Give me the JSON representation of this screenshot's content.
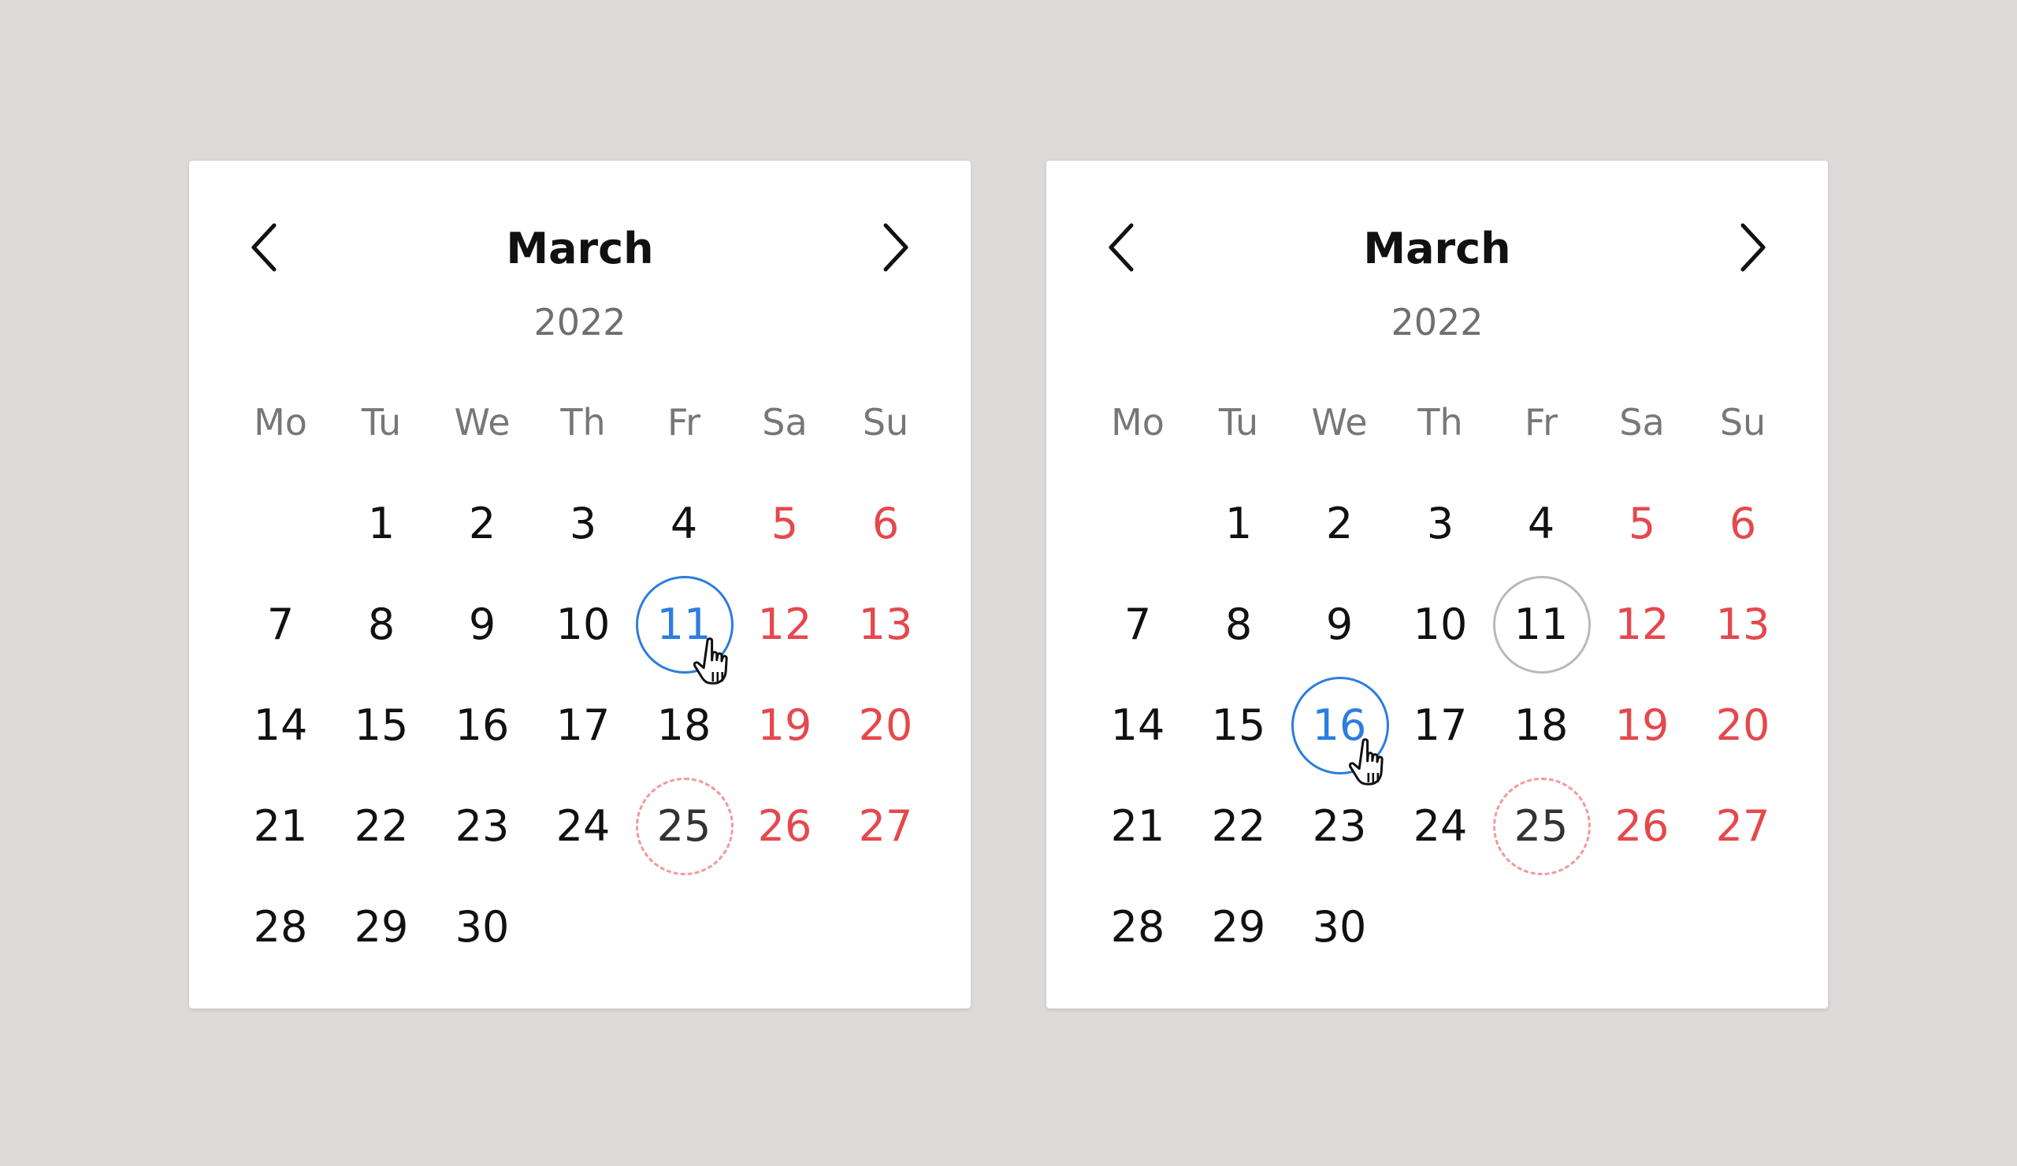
{
  "weekdays": [
    "Mo",
    "Tu",
    "We",
    "Th",
    "Fr",
    "Sa",
    "Su"
  ],
  "colors": {
    "background": "#dcdbda",
    "weekend": "#e5484d",
    "selected": "#2b7de0",
    "previous_ring": "#b9b9b9",
    "event_ring": "#f29a9a"
  },
  "icons": {
    "prev": "chevron-left-icon",
    "next": "chevron-right-icon",
    "cursor": "hand-pointer-icon"
  },
  "calendars": [
    {
      "month": "March",
      "year": "2022",
      "days": [
        {
          "label": "",
          "type": "blank"
        },
        {
          "label": "1",
          "type": "weekday"
        },
        {
          "label": "2",
          "type": "weekday"
        },
        {
          "label": "3",
          "type": "weekday"
        },
        {
          "label": "4",
          "type": "weekday"
        },
        {
          "label": "5",
          "type": "weekend"
        },
        {
          "label": "6",
          "type": "weekend"
        },
        {
          "label": "7",
          "type": "weekday"
        },
        {
          "label": "8",
          "type": "weekday"
        },
        {
          "label": "9",
          "type": "weekday"
        },
        {
          "label": "10",
          "type": "weekday"
        },
        {
          "label": "11",
          "type": "weekday",
          "state": "selected",
          "hover": true
        },
        {
          "label": "12",
          "type": "weekend"
        },
        {
          "label": "13",
          "type": "weekend"
        },
        {
          "label": "14",
          "type": "weekday"
        },
        {
          "label": "15",
          "type": "weekday"
        },
        {
          "label": "16",
          "type": "weekday"
        },
        {
          "label": "17",
          "type": "weekday"
        },
        {
          "label": "18",
          "type": "weekday"
        },
        {
          "label": "19",
          "type": "weekend"
        },
        {
          "label": "20",
          "type": "weekend"
        },
        {
          "label": "21",
          "type": "weekday"
        },
        {
          "label": "22",
          "type": "weekday"
        },
        {
          "label": "23",
          "type": "weekday"
        },
        {
          "label": "24",
          "type": "weekday"
        },
        {
          "label": "25",
          "type": "weekday",
          "state": "event"
        },
        {
          "label": "26",
          "type": "weekend"
        },
        {
          "label": "27",
          "type": "weekend"
        },
        {
          "label": "28",
          "type": "weekday"
        },
        {
          "label": "29",
          "type": "weekday"
        },
        {
          "label": "30",
          "type": "weekday"
        }
      ]
    },
    {
      "month": "March",
      "year": "2022",
      "days": [
        {
          "label": "",
          "type": "blank"
        },
        {
          "label": "1",
          "type": "weekday"
        },
        {
          "label": "2",
          "type": "weekday"
        },
        {
          "label": "3",
          "type": "weekday"
        },
        {
          "label": "4",
          "type": "weekday"
        },
        {
          "label": "5",
          "type": "weekend"
        },
        {
          "label": "6",
          "type": "weekend"
        },
        {
          "label": "7",
          "type": "weekday"
        },
        {
          "label": "8",
          "type": "weekday"
        },
        {
          "label": "9",
          "type": "weekday"
        },
        {
          "label": "10",
          "type": "weekday"
        },
        {
          "label": "11",
          "type": "weekday",
          "state": "previous"
        },
        {
          "label": "12",
          "type": "weekend"
        },
        {
          "label": "13",
          "type": "weekend"
        },
        {
          "label": "14",
          "type": "weekday"
        },
        {
          "label": "15",
          "type": "weekday"
        },
        {
          "label": "16",
          "type": "weekday",
          "state": "selected",
          "hover": true
        },
        {
          "label": "17",
          "type": "weekday"
        },
        {
          "label": "18",
          "type": "weekday"
        },
        {
          "label": "19",
          "type": "weekend"
        },
        {
          "label": "20",
          "type": "weekend"
        },
        {
          "label": "21",
          "type": "weekday"
        },
        {
          "label": "22",
          "type": "weekday"
        },
        {
          "label": "23",
          "type": "weekday"
        },
        {
          "label": "24",
          "type": "weekday"
        },
        {
          "label": "25",
          "type": "weekday",
          "state": "event"
        },
        {
          "label": "26",
          "type": "weekend"
        },
        {
          "label": "27",
          "type": "weekend"
        },
        {
          "label": "28",
          "type": "weekday"
        },
        {
          "label": "29",
          "type": "weekday"
        },
        {
          "label": "30",
          "type": "weekday"
        }
      ]
    }
  ]
}
